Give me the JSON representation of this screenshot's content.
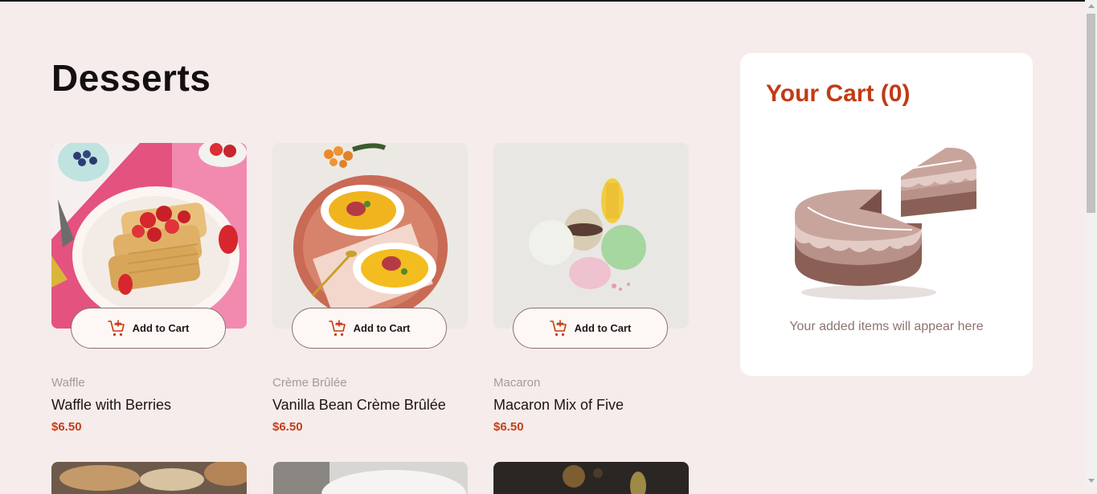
{
  "page": {
    "title": "Desserts"
  },
  "products": [
    {
      "category": "Waffle",
      "name": "Waffle with Berries",
      "price": "$6.50",
      "button_label": "Add to Cart"
    },
    {
      "category": "Crème Brûlée",
      "name": "Vanilla Bean Crème Brûlée",
      "price": "$6.50",
      "button_label": "Add to Cart"
    },
    {
      "category": "Macaron",
      "name": "Macaron Mix of Five",
      "price": "$6.50",
      "button_label": "Add to Cart"
    }
  ],
  "cart": {
    "title": "Your Cart (0)",
    "empty_message": "Your added items will appear here",
    "illustration": "empty-cake-illustration"
  },
  "icons": {
    "add_to_cart": "cart-plus-icon"
  },
  "colors": {
    "background": "#f5eceb",
    "accent": "#c13b16",
    "price": "#c2401a",
    "muted_text": "#a9999a"
  }
}
